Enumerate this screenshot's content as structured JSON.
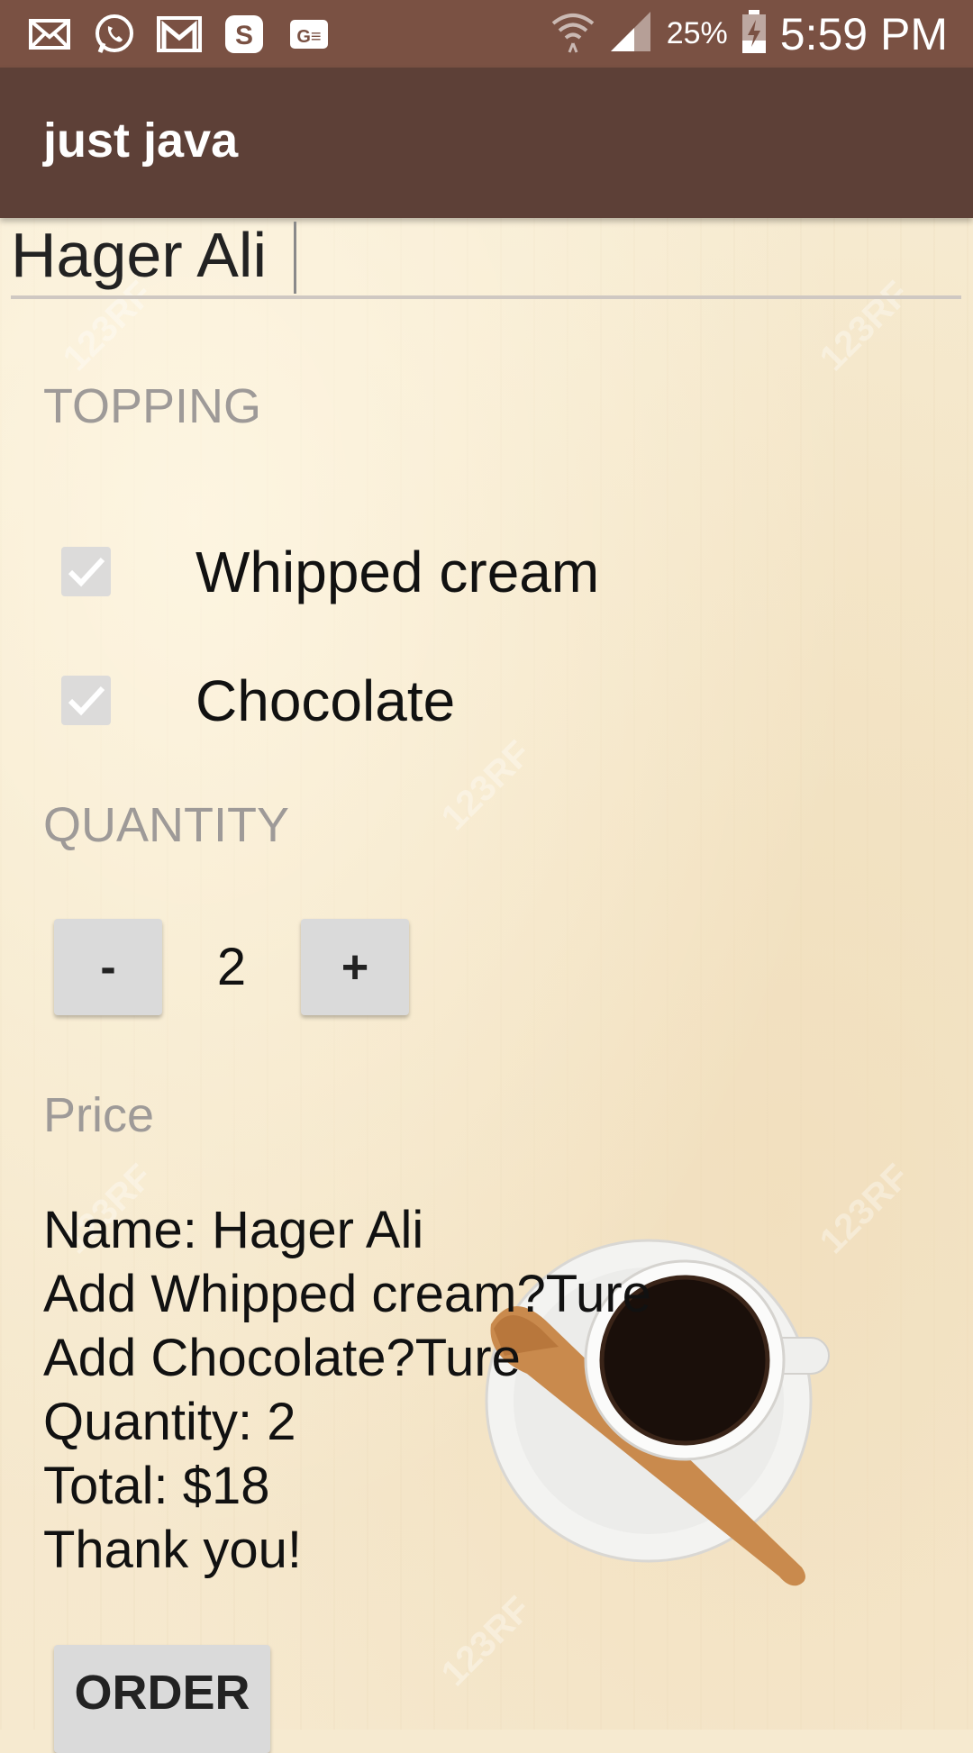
{
  "status_bar": {
    "icons": [
      "mail-icon",
      "whatsapp-icon",
      "gmail-icon",
      "skype-icon",
      "ge-icon",
      "wifi-icon",
      "signal-icon",
      "battery-charging-icon"
    ],
    "battery": "25%",
    "time": "5:59 PM"
  },
  "app_bar": {
    "title": "just java"
  },
  "name_field": {
    "value": "Hager Ali"
  },
  "topping": {
    "header": "TOPPING",
    "options": [
      {
        "label": "Whipped cream",
        "checked": true
      },
      {
        "label": "Chocolate",
        "checked": true
      }
    ]
  },
  "quantity": {
    "header": "QUANTITY",
    "decrement_label": "-",
    "value": "2",
    "increment_label": "+"
  },
  "price": {
    "header": "Price",
    "summary_lines": [
      "Name: Hager Ali",
      "Add Whipped cream?Ture",
      "Add Chocolate?Ture",
      "Quantity: 2",
      "Total: $18",
      "Thank you!"
    ]
  },
  "order_button": {
    "label": "ORDER"
  },
  "colors": {
    "status_bar": "#7a5143",
    "app_bar": "#5d4037",
    "background": "#f6ead0",
    "button": "#dadada",
    "header_text": "#9e9a98"
  },
  "background_image": {
    "subject": "coffee-cup-on-saucer-with-wooden-spoon",
    "watermark": "123RF"
  }
}
